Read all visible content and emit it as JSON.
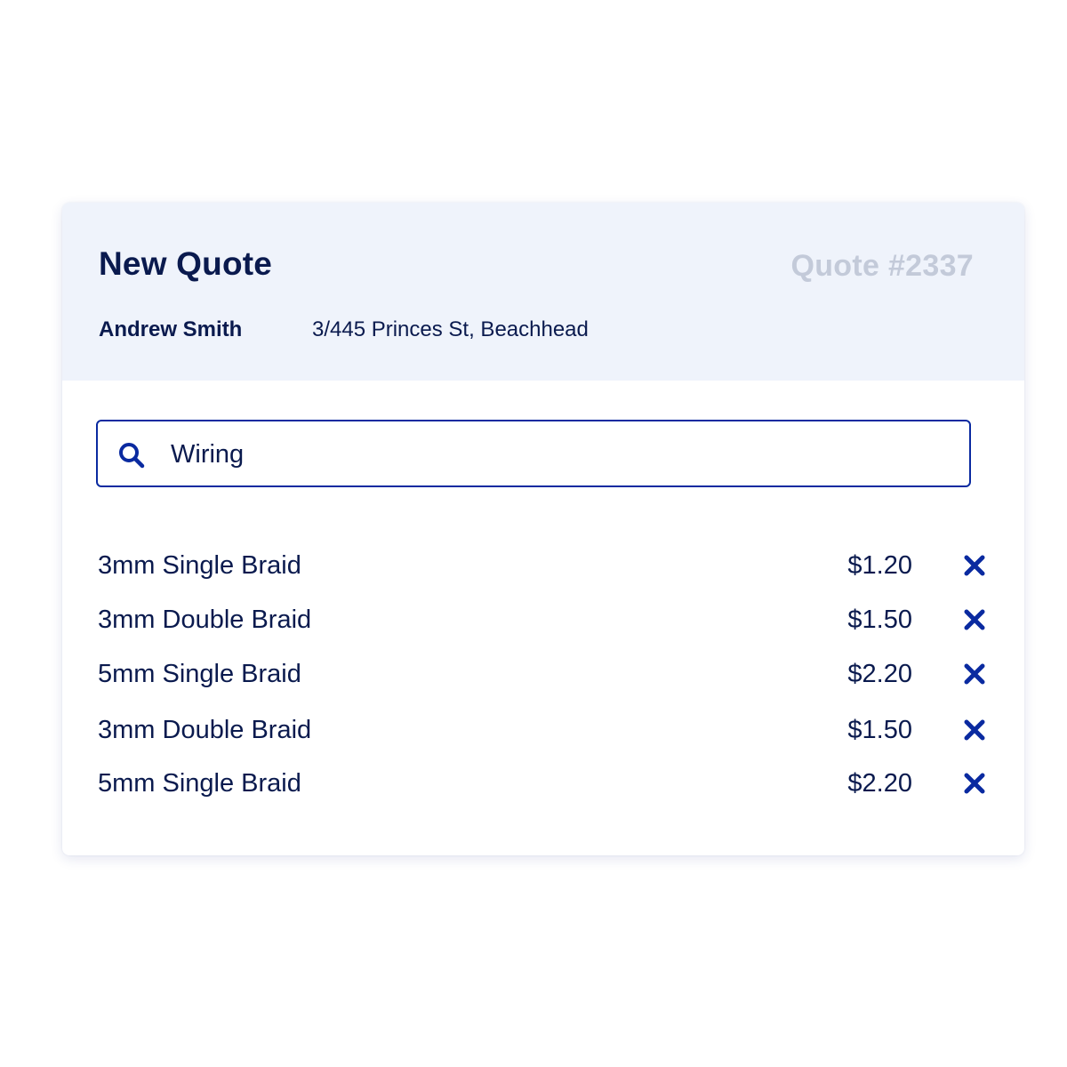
{
  "header": {
    "title": "New Quote",
    "quote_number": "Quote #2337",
    "customer_name": "Andrew Smith",
    "customer_address": "3/445 Princes St, Beachhead"
  },
  "search": {
    "value": "Wiring",
    "icon": "search-icon"
  },
  "items": [
    {
      "name": "3mm Single Braid",
      "price": "$1.20",
      "remove_icon": "close-icon"
    },
    {
      "name": "3mm Double Braid",
      "price": "$1.50",
      "remove_icon": "close-icon"
    },
    {
      "name": "5mm Single Braid",
      "price": "$2.20",
      "remove_icon": "close-icon"
    },
    {
      "name": "3mm Double Braid",
      "price": "$1.50",
      "remove_icon": "close-icon"
    },
    {
      "name": "5mm Single Braid",
      "price": "$2.20",
      "remove_icon": "close-icon"
    }
  ],
  "colors": {
    "accent": "#0a2aa0",
    "text": "#0a1a4e",
    "muted": "#c3cad9",
    "header_bg": "#eff3fb"
  }
}
